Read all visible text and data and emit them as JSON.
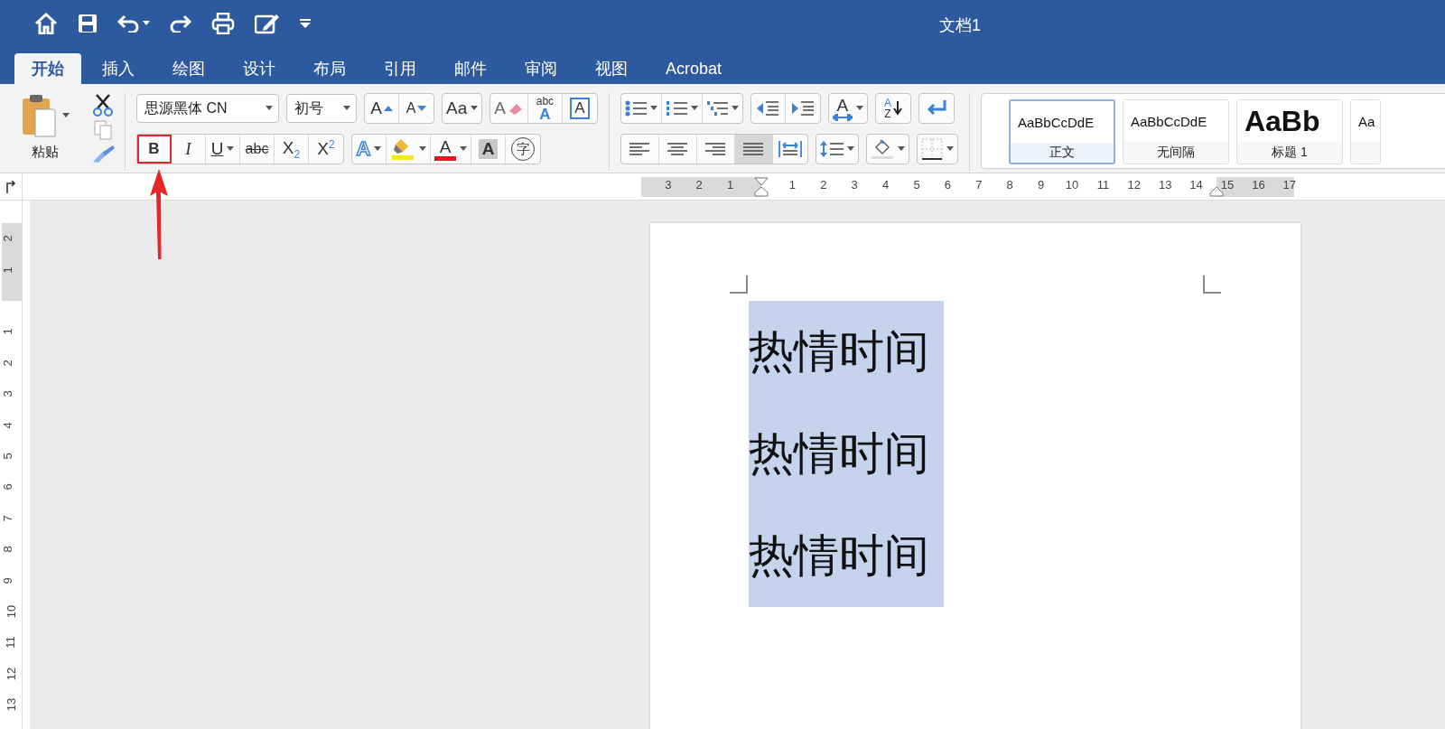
{
  "window": {
    "title": "文档1"
  },
  "tabs": [
    {
      "label": "开始",
      "selected": true
    },
    {
      "label": "插入",
      "selected": false
    },
    {
      "label": "绘图",
      "selected": false
    },
    {
      "label": "设计",
      "selected": false
    },
    {
      "label": "布局",
      "selected": false
    },
    {
      "label": "引用",
      "selected": false
    },
    {
      "label": "邮件",
      "selected": false
    },
    {
      "label": "审阅",
      "selected": false
    },
    {
      "label": "视图",
      "selected": false
    },
    {
      "label": "Acrobat",
      "selected": false
    }
  ],
  "clipboard": {
    "paste_label": "粘贴"
  },
  "font_group": {
    "font_name": "思源黑体 CN",
    "font_size": "初号",
    "row1": [
      {
        "kind": "grow",
        "glyph": "A"
      },
      {
        "kind": "shrink",
        "glyph": "A"
      },
      {
        "kind": "case",
        "glyph": "Aa",
        "menu": true
      },
      {
        "kind": "clear",
        "glyph": "A"
      },
      {
        "kind": "phonetic",
        "glyph": "abc",
        "glyph2": "A"
      },
      {
        "kind": "border",
        "glyph": "A"
      }
    ],
    "row2": [
      {
        "kind": "bold",
        "glyph": "B",
        "annotated": true
      },
      {
        "kind": "italic",
        "glyph": "I",
        "annotated": false
      },
      {
        "kind": "underline",
        "glyph": "U",
        "menu": true,
        "annotated": false
      },
      {
        "kind": "strike",
        "glyph": "abc",
        "annotated": false
      },
      {
        "kind": "subscript",
        "glyph": "X",
        "glyph2": "2",
        "annotated": false
      },
      {
        "kind": "superscript",
        "glyph": "X",
        "glyph2": "2",
        "annotated": false
      }
    ],
    "row3": [
      {
        "kind": "effects",
        "glyph": "A",
        "menu": true
      },
      {
        "kind": "highlight",
        "menu": true
      },
      {
        "kind": "color",
        "glyph": "A",
        "menu": true
      },
      {
        "kind": "shade",
        "glyph": "A"
      },
      {
        "kind": "enclose",
        "glyph": "字"
      }
    ]
  },
  "paragraph_group": {
    "direction_glyph": "A",
    "sort_glyphs": [
      "A",
      "Z"
    ],
    "alignment": [
      {
        "pressed": false
      },
      {
        "pressed": false
      },
      {
        "pressed": false
      },
      {
        "pressed": true
      }
    ]
  },
  "styles": [
    {
      "kind": "normal",
      "preview": "AaBbCcDdE",
      "label": "正文",
      "selected": true
    },
    {
      "kind": "normal",
      "preview": "AaBbCcDdE",
      "label": "无间隔",
      "selected": false
    },
    {
      "kind": "heading",
      "preview": "AaBb",
      "label": "标题 1",
      "selected": false
    },
    {
      "kind": "normal",
      "preview": "Aa",
      "selected": false
    }
  ],
  "horizontal_ruler": {
    "left_labels": [
      "3",
      "2",
      "1"
    ],
    "right_labels": [
      "1",
      "2",
      "3",
      "4",
      "5",
      "6",
      "7",
      "8",
      "9",
      "10",
      "11",
      "12",
      "13",
      "14",
      "15",
      "16",
      "17"
    ]
  },
  "vertical_ruler": {
    "above_labels": [
      "2",
      "1"
    ],
    "below_labels": [
      "1",
      "2",
      "3",
      "4",
      "5",
      "6",
      "7",
      "8",
      "9",
      "10",
      "11",
      "12",
      "13"
    ]
  },
  "document": {
    "paragraphs": [
      {
        "text": "热情时间",
        "selected": true
      },
      {
        "text": "热情时间",
        "selected": true
      },
      {
        "text": "热情时间",
        "selected": true
      }
    ]
  }
}
